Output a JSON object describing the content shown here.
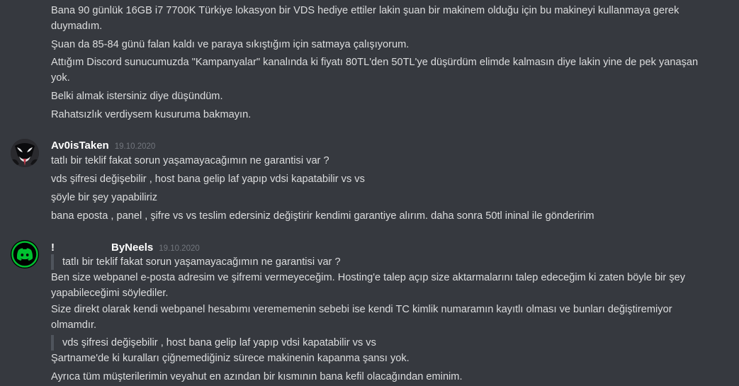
{
  "top_message": {
    "lines": [
      "Bana 90 günlük 16GB i7 7700K Türkiye lokasyon bir VDS hediye ettiler lakin şuan bir makinem olduğu için bu makineyi kullanmaya gerek duymadım.",
      "Şuan da 85-84 günü falan kaldı ve paraya sıkıştığım için satmaya çalışıyorum.",
      "Attığım Discord sunucumuzda \"Kampanyalar\" kanalında ki fiyatı 80TL'den 50TL'ye düşürdüm elimde kalmasın diye lakin yine de pek yanaşan yok.",
      "Belki almak istersiniz diye düşündüm.",
      "Rahatsızlık verdiysem kusuruma bakmayın."
    ]
  },
  "message1": {
    "username": "Av0isTaken",
    "timestamp": "19.10.2020",
    "avatar_icon": "venom-avatar-icon",
    "lines": [
      "tatlı bir teklif fakat sorun yaşamayacağımın ne garantisi var ?",
      "vds şifresi değişebilir , host bana gelip laf yapıp vdsi kapatabilir vs vs",
      "şöyle bir şey yapabiliriz",
      "bana eposta , panel , şifre vs vs teslim edersiniz değiştirir kendimi garantiye alırım. daha sonra 50tl ininal ile gönderirim"
    ]
  },
  "message2": {
    "prefix": "!",
    "username": "ByNeels",
    "timestamp": "19.10.2020",
    "avatar_icon": "discord-logo-icon",
    "avatar_color": "#00c030",
    "quote1": "tatlı bir teklif fakat sorun yaşamayacağımın ne garantisi var ?",
    "para1": "Ben size webpanel e-posta adresim ve şifremi vermeyeceğim. Hosting'e talep açıp size aktarmalarını talep edeceğim ki zaten böyle bir şey yapabileceğimi söylediler.",
    "para2": "Size direkt olarak kendi webpanel hesabımı verememenin sebebi ise kendi TC kimlik numaramın kayıtlı olması ve bunları değiştiremiyor olmamdır.",
    "quote2": "vds şifresi değişebilir , host bana gelip laf yapıp vdsi kapatabilir vs vs",
    "line3": "Şartname'de ki kuralları çiğnemediğiniz sürece makinenin kapanma şansı yok.",
    "line4": "Ayrıca tüm müşterilerimin veyahut en azından bir kısmının bana kefil olacağından eminim."
  }
}
